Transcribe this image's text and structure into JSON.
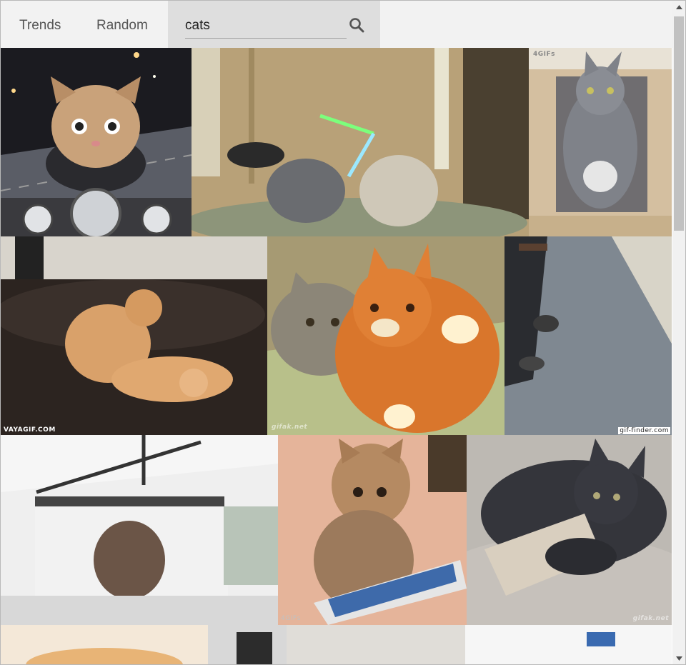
{
  "nav": {
    "trends_label": "Trends",
    "random_label": "Random",
    "search_value": "cats",
    "search_icon": "search-icon"
  },
  "gifs": [
    {
      "id": "motorcycle-cat"
    },
    {
      "id": "lightsaber-kittens"
    },
    {
      "id": "cats-in-wooden-box",
      "watermark": "4GIFs"
    },
    {
      "id": "cats-wrestling-on-sofa",
      "watermark": "VAYAGIF.COM"
    },
    {
      "id": "orange-cat-hugging-grey-cat",
      "watermark": "gifak.net"
    },
    {
      "id": "cat-in-hallway",
      "watermark": "gif-finder.com"
    },
    {
      "id": "fluffy-cat-on-wall"
    },
    {
      "id": "kitten-with-phone",
      "watermark": "4GIFs"
    },
    {
      "id": "grey-kitten-with-money",
      "watermark": "gifak.net"
    },
    {
      "id": "partial-row-cat"
    }
  ],
  "colors": {
    "nav_bg": "#f2f2f2",
    "search_bg": "#dedede",
    "text": "#555555"
  }
}
